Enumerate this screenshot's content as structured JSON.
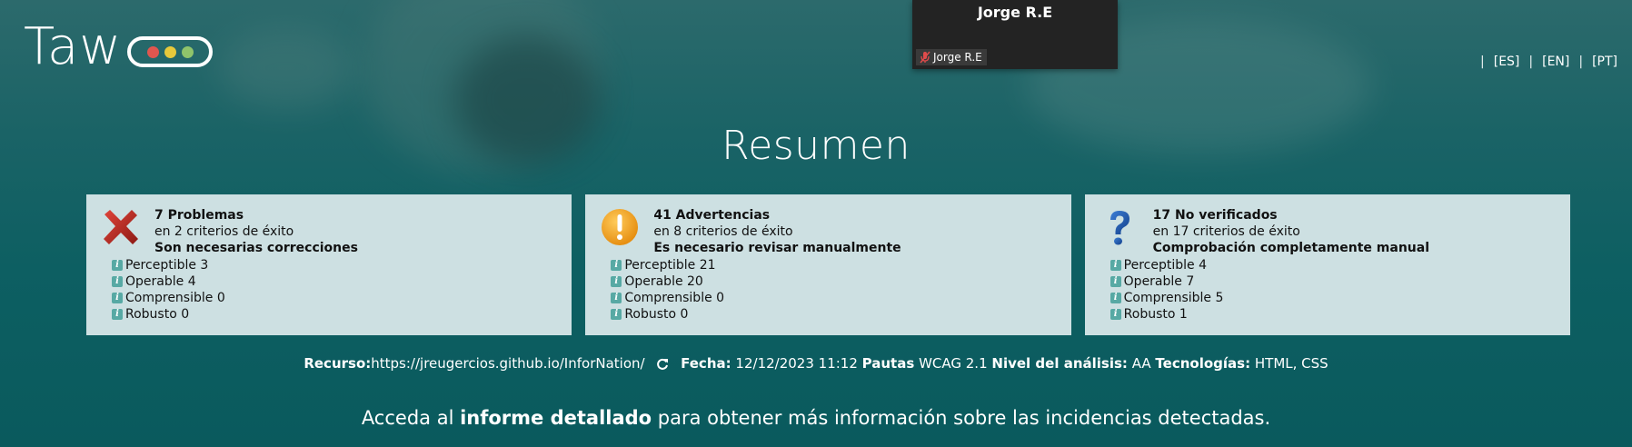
{
  "logo": {
    "text": "Taw",
    "dots": [
      "#e0564f",
      "#e7c93b",
      "#8fc46b"
    ]
  },
  "video_tile": {
    "name": "Jorge R.E",
    "label": "Jorge R.E",
    "mic_icon": "muted-mic-icon"
  },
  "languages": [
    "[ES]",
    "[EN]",
    "[PT]"
  ],
  "title": "Resumen",
  "cards": [
    {
      "icon": "cross-icon",
      "count_label": "7 Problemas",
      "criteria": "en 2 criterios de éxito",
      "note": "Son necesarias correcciones",
      "items": [
        {
          "label": "Perceptible 3"
        },
        {
          "label": "Operable 4"
        },
        {
          "label": "Comprensible 0"
        },
        {
          "label": "Robusto 0"
        }
      ]
    },
    {
      "icon": "warning-icon",
      "count_label": "41 Advertencias",
      "criteria": "en 8 criterios de éxito",
      "note": "Es necesario revisar manualmente",
      "items": [
        {
          "label": "Perceptible 21"
        },
        {
          "label": "Operable 20"
        },
        {
          "label": "Comprensible 0"
        },
        {
          "label": "Robusto 0"
        }
      ]
    },
    {
      "icon": "question-icon",
      "count_label": "17 No verificados",
      "criteria": "en 17 criterios de éxito",
      "note": "Comprobación completamente manual",
      "items": [
        {
          "label": "Perceptible 4"
        },
        {
          "label": "Operable 7"
        },
        {
          "label": "Comprensible 5"
        },
        {
          "label": "Robusto 1"
        }
      ]
    }
  ],
  "meta": {
    "resource_label": "Recurso:",
    "resource_url": "https://jreugercios.github.io/InforNation/",
    "date_label": "Fecha:",
    "date_value": "12/12/2023 11:12",
    "guidelines_label": "Pautas",
    "guidelines_value": "WCAG 2.1",
    "level_label": "Nivel del análisis:",
    "level_value": "AA",
    "tech_label": "Tecnologías:",
    "tech_value": "HTML, CSS"
  },
  "footer": {
    "pre": "Acceda al ",
    "link": "informe detallado",
    "post": " para obtener más información sobre las incidencias detectadas."
  }
}
